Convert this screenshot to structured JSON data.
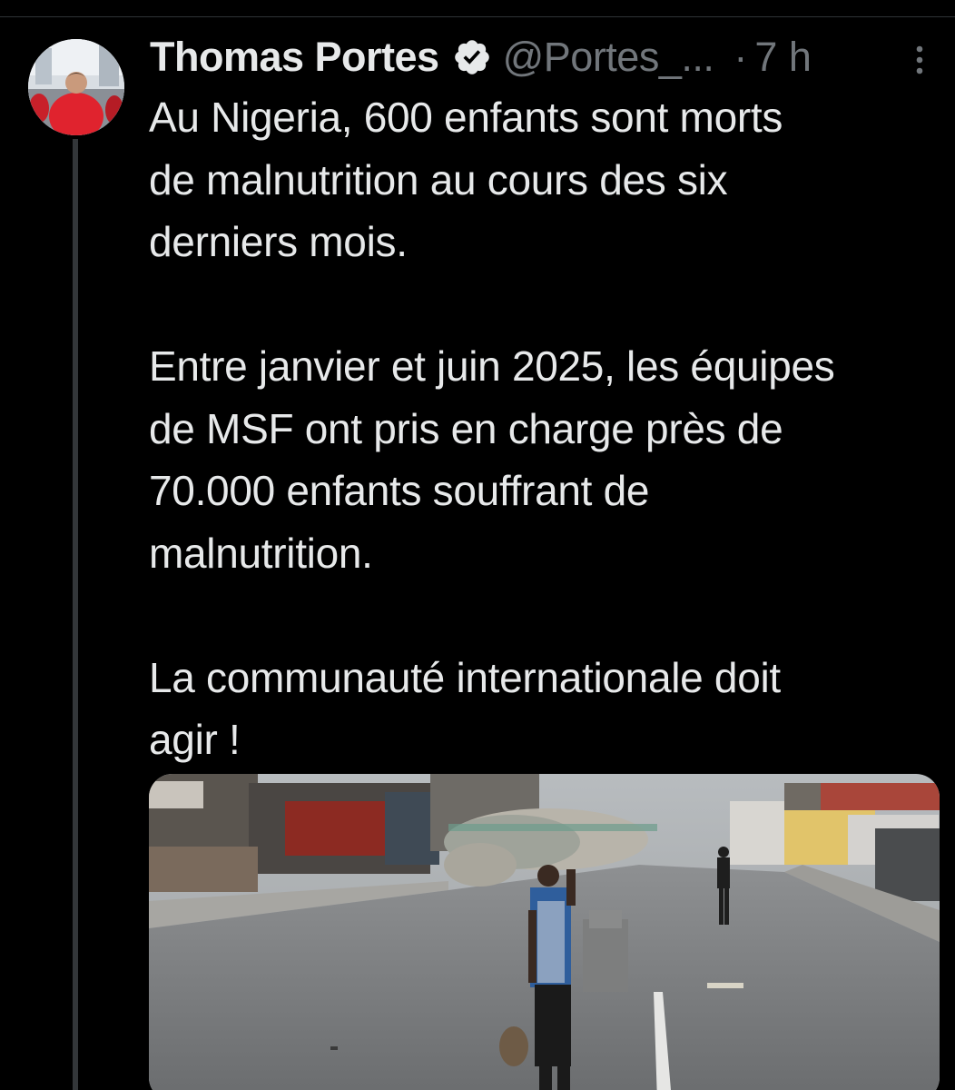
{
  "tweet": {
    "author": {
      "display_name": "Thomas Portes",
      "handle": "@Portes_...",
      "verified": true
    },
    "timestamp": "7 h",
    "separator": "·",
    "text": "Au Nigeria, 600 enfants sont morts\nde malnutrition au cours des six\nderniers mois.\n\nEntre janvier et juin 2025, les équipes\nde MSF ont pris en charge près de\n70.000 enfants souffrant de\nmalnutrition.\n\nLa communauté internationale doit\nagir !",
    "media": {
      "kind": "photo"
    }
  },
  "icons": {
    "verified": "verified-badge-icon",
    "more": "more-options-icon"
  },
  "colors": {
    "background": "#000000",
    "text_primary": "#e7e9ea",
    "text_secondary": "#71767b",
    "thread_line": "#333639"
  }
}
